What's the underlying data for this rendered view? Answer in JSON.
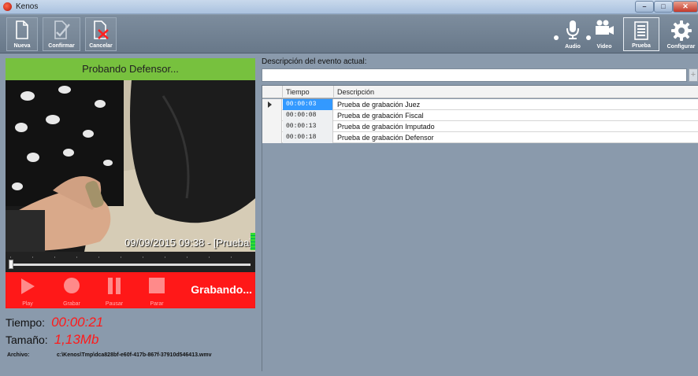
{
  "window": {
    "title": "Kenos",
    "controls": {
      "minimize": "–",
      "maximize": "□",
      "close": "✕"
    }
  },
  "toolbar": {
    "new_label": "Nueva",
    "confirm_label": "Confirmar",
    "cancel_label": "Cancelar",
    "audio_label": "Audio",
    "video_label": "Video",
    "test_label": "Prueba",
    "config_label": "Configurar"
  },
  "recorder": {
    "header": "Probando Defensor...",
    "video_overlay": "09/09/2015 09:38 - [Prueba]",
    "seek_position": 0.0,
    "buttons": {
      "play": "Play",
      "record": "Grabar",
      "pause": "Pausar",
      "stop": "Parar"
    },
    "status": "Grabando...",
    "time_label": "Tiempo:",
    "time_value": "00:00:21",
    "size_label": "Tamaño:",
    "size_value": "1,13Mb",
    "file_label": "Archivo:",
    "file_path": "c:\\Kenos\\Tmp\\dca828bf-e60f-417b-867f-37910d546413.wmv",
    "accent_color": "#ff1818",
    "header_color": "#77c13e"
  },
  "events": {
    "description_label": "Descripción del evento actual:",
    "description_value": "",
    "add_button": "+",
    "columns": [
      "Tiempo",
      "Descripción"
    ],
    "rows": [
      {
        "time": "00:00:03",
        "description": "Prueba de grabación Juez"
      },
      {
        "time": "00:00:08",
        "description": "Prueba de grabación Fiscal"
      },
      {
        "time": "00:00:13",
        "description": "Prueba de grabación Imputado"
      },
      {
        "time": "00:00:18",
        "description": "Prueba de grabación Defensor"
      }
    ],
    "selected_row": 0
  }
}
